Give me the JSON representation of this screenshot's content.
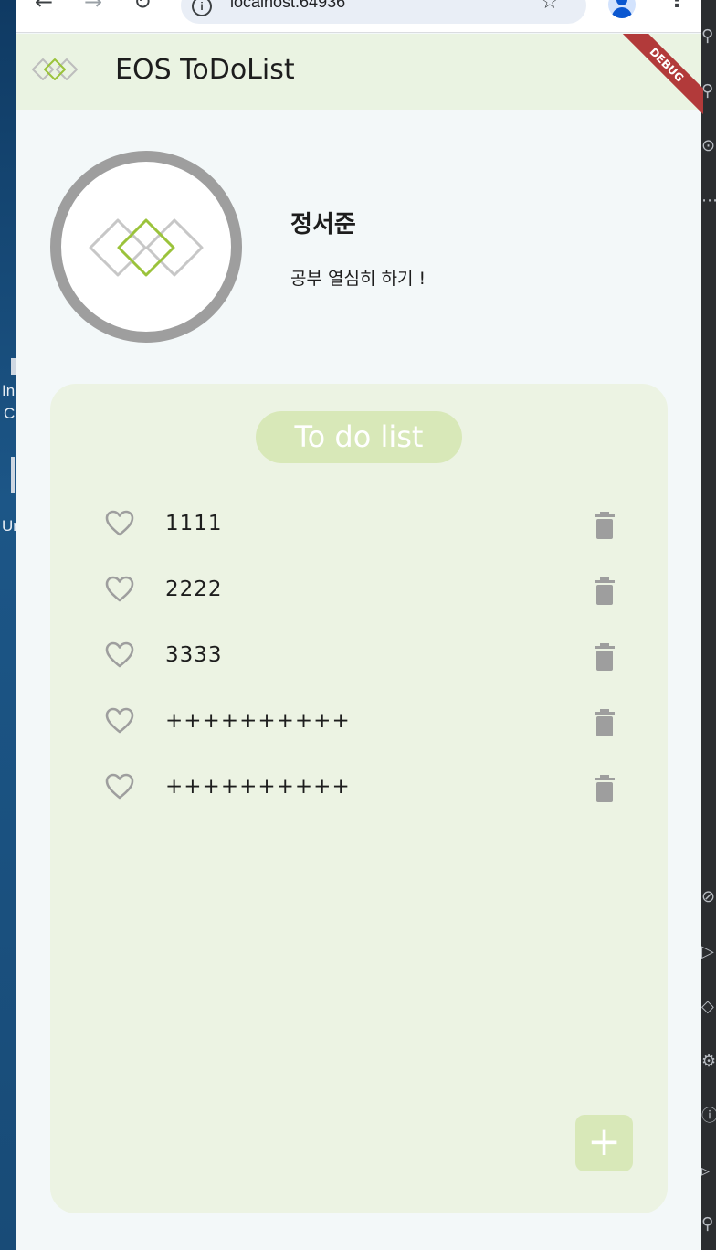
{
  "desktop": {
    "labels": [
      "In",
      "Co",
      "Ur"
    ]
  },
  "browser": {
    "url": "localhost:64936",
    "nav": {
      "back": "←",
      "forward": "→",
      "reload": "↻"
    },
    "star": "☆",
    "menu": "⋮"
  },
  "app": {
    "title": "EOS ToDoList",
    "debug_label": "DEBUG"
  },
  "profile": {
    "name": "정서준",
    "motto": "공부 열심히 하기 !"
  },
  "todo": {
    "title": "To do list",
    "items": [
      {
        "text": "1111"
      },
      {
        "text": "2222"
      },
      {
        "text": "3333"
      },
      {
        "text": "++++++++++"
      },
      {
        "text": "++++++++++"
      }
    ],
    "add_label": "+"
  },
  "colors": {
    "appbar": "#eaf3e2",
    "card": "#ecf3e3",
    "accent_light": "#d8e8b8",
    "logo_green": "#9bc33b",
    "debug": "#b23a3a",
    "icon_gray": "#9e9e9e"
  }
}
